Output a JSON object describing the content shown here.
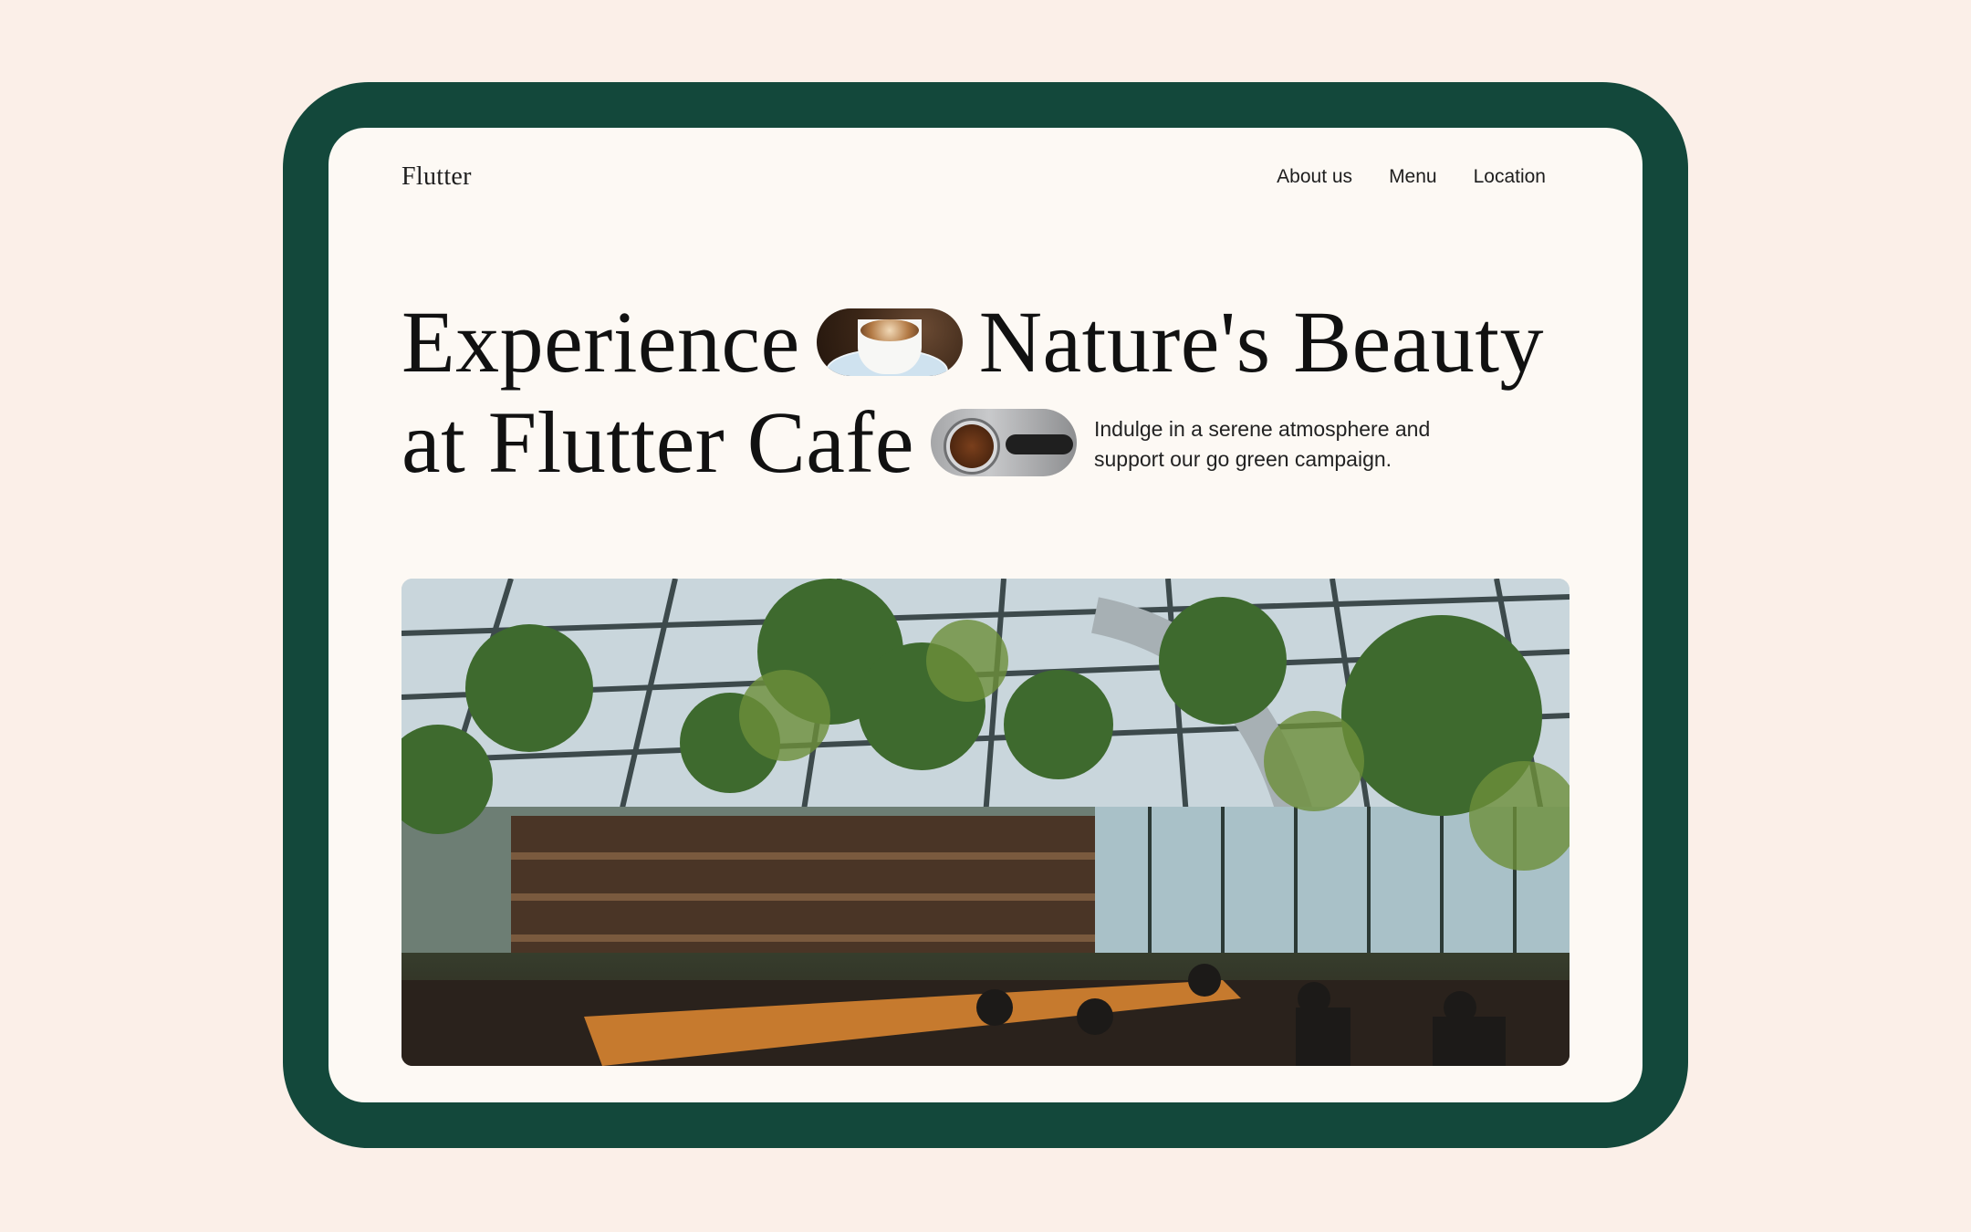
{
  "header": {
    "brand": "Flutter",
    "nav": [
      "About us",
      "Menu",
      "Location"
    ]
  },
  "hero": {
    "headline_line1_a": "Experience",
    "headline_line1_b": "Nature's Beauty",
    "headline_line2": "at Flutter Cafe",
    "tagline": "Indulge in a serene atmosphere and support our go green campaign.",
    "image_alt": "cafe greenhouse interior photo"
  },
  "colors": {
    "background": "#fbefe8",
    "frame": "#13483b",
    "screen": "#fdf9f4",
    "text": "#111111"
  }
}
